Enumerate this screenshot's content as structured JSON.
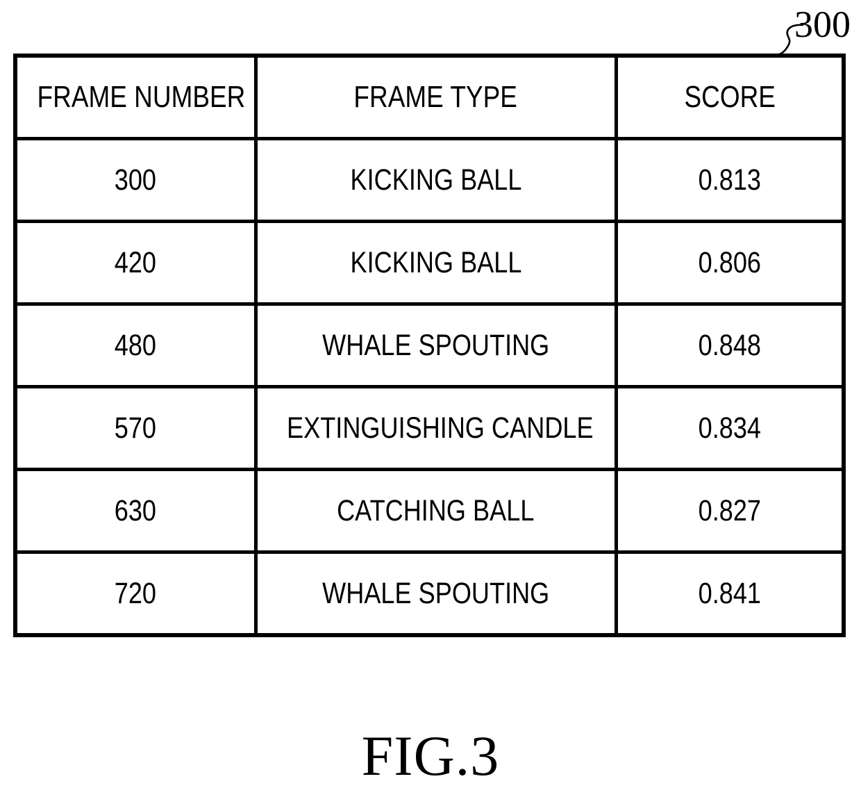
{
  "figure": {
    "reference_numeral": "300",
    "caption": "FIG.3"
  },
  "table": {
    "columns": [
      {
        "key": "frame_number",
        "label": "FRAME NUMBER"
      },
      {
        "key": "frame_type",
        "label": "FRAME TYPE"
      },
      {
        "key": "score",
        "label": "SCORE"
      }
    ],
    "rows": [
      {
        "frame_number": "300",
        "frame_type": "KICKING BALL",
        "score": "0.813"
      },
      {
        "frame_number": "420",
        "frame_type": "KICKING BALL",
        "score": "0.806"
      },
      {
        "frame_number": "480",
        "frame_type": "WHALE SPOUTING",
        "score": "0.848"
      },
      {
        "frame_number": "570",
        "frame_type": "EXTINGUISHING CANDLE",
        "score": "0.834"
      },
      {
        "frame_number": "630",
        "frame_type": "CATCHING BALL",
        "score": "0.827"
      },
      {
        "frame_number": "720",
        "frame_type": "WHALE SPOUTING",
        "score": "0.841"
      }
    ]
  },
  "colors": {
    "ink": "#000000",
    "page": "#ffffff"
  }
}
